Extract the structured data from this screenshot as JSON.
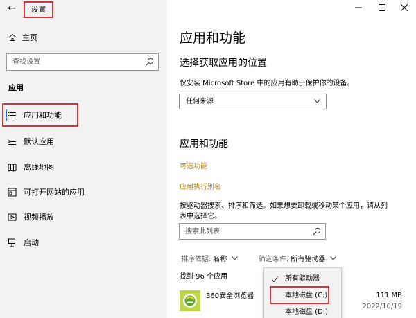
{
  "window": {
    "title": "设置",
    "back_label": "←"
  },
  "sidebar": {
    "home": "主页",
    "search_placeholder": "查找设置",
    "section": "应用",
    "items": [
      {
        "label": "应用和功能",
        "icon": "apps-features-icon"
      },
      {
        "label": "默认应用",
        "icon": "default-apps-icon"
      },
      {
        "label": "离线地图",
        "icon": "offline-maps-icon"
      },
      {
        "label": "可打开网站的应用",
        "icon": "apps-for-websites-icon"
      },
      {
        "label": "视频播放",
        "icon": "video-playback-icon"
      },
      {
        "label": "启动",
        "icon": "startup-icon"
      }
    ]
  },
  "main": {
    "title": "应用和功能",
    "install_source": {
      "heading": "选择获取应用的位置",
      "description": "仅安装 Microsoft Store 中的应用有助于保护你的设备。",
      "selected": "任何来源"
    },
    "apps_section": {
      "heading": "应用和功能",
      "link_optional": "可选功能",
      "link_alias": "应用执行别名",
      "description_line1": "按驱动器搜索、排序和筛选。如果想要卸载或移动某个应用，请从列",
      "description_line2": "表中选择它。",
      "search_placeholder": "搜索此列表",
      "sort_label": "排序依据:",
      "sort_value": "名称",
      "filter_label": "筛选条件:",
      "filter_value": "所有驱动器",
      "count_text": "找到 96 个应用"
    },
    "apps": [
      {
        "name": "360安全浏览器",
        "size": "111 MB",
        "date": "2022/10/19"
      }
    ]
  },
  "filter_menu": {
    "options": [
      {
        "label": "所有驱动器",
        "checked": true
      },
      {
        "label": "本地磁盘 (C:)",
        "checked": false,
        "highlighted": true
      },
      {
        "label": "本地磁盘 (D:)",
        "checked": false
      }
    ]
  },
  "colors": {
    "accent": "#1a6fd0",
    "link": "#b88a12",
    "highlight_box": "#d9333a",
    "sidebar_bg": "#f2f2f2"
  }
}
